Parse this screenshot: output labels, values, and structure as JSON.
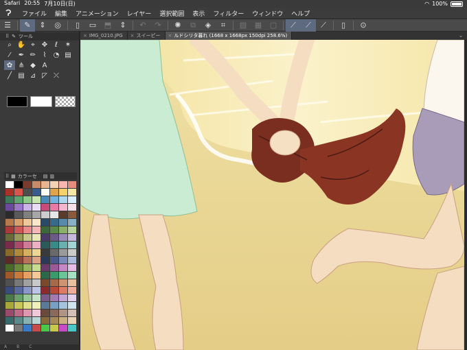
{
  "status": {
    "browser": "Safari",
    "time": "20:55",
    "date": "7月10日(日)",
    "battery": "100%",
    "battery_level": 1.0
  },
  "menubar": {
    "items": [
      "ファイル",
      "編集",
      "アニメーション",
      "レイヤー",
      "選択範囲",
      "表示",
      "フィルター",
      "ウィンドウ",
      "ヘルプ"
    ]
  },
  "tool_panel": {
    "tab_label": "ツール"
  },
  "palette_panel": {
    "tab_label": "カラーセ",
    "colors": [
      "#ffffff",
      "#000000",
      "#7a3b2e",
      "#c78b6a",
      "#e8b58f",
      "#f3d2b5",
      "#f7b6b0",
      "#e88c7d",
      "#a83226",
      "#d9544b",
      "#4d4d4d",
      "#3a5a8c",
      "#ffffff",
      "#e0a24a",
      "#f5d06b",
      "#f6e9a8",
      "#3d7a5a",
      "#5fa36f",
      "#8fc98a",
      "#c8e6b0",
      "#4a8ab8",
      "#74b3dc",
      "#aed7ee",
      "#dcefff",
      "#6a4a9a",
      "#9a7ac8",
      "#c9b3e6",
      "#e9dcf6",
      "#c84a7a",
      "#e87aa8",
      "#f4b6ce",
      "#fbe0ea",
      "#2b2b2b",
      "#595959",
      "#808080",
      "#a6a6a6",
      "#cccccc",
      "#e6e6e6",
      "#5a3a2a",
      "#8a5a3a",
      "#b87a4a",
      "#d8a06a",
      "#efc79a",
      "#fbe6c8",
      "#2a4a6a",
      "#3a6a8a",
      "#5a8aaa",
      "#8ab0c8",
      "#aa3a3a",
      "#cc5a5a",
      "#e88a8a",
      "#f5b8b8",
      "#3a6a3a",
      "#5a8a4a",
      "#8ab06a",
      "#b8d49a",
      "#6a6a3a",
      "#9a9a5a",
      "#c8c88a",
      "#e8e8b8",
      "#4a3a6a",
      "#6a5a8a",
      "#9a8ab8",
      "#c8b8e0",
      "#7a2a4a",
      "#a84a6a",
      "#d07a98",
      "#ecb0c4",
      "#2a5a5a",
      "#3a8a8a",
      "#6ab0b0",
      "#a0d4d4",
      "#8a6a2a",
      "#b08a3a",
      "#d4b060",
      "#ecd694",
      "#3a3a3a",
      "#6a6a6a",
      "#9a9a9a",
      "#cacaca",
      "#5a2a2a",
      "#8a4a3a",
      "#b8745a",
      "#dca486",
      "#2a3a5a",
      "#4a5a8a",
      "#7a8ab8",
      "#acbadc",
      "#4a6a2a",
      "#6a8a3a",
      "#9ab45a",
      "#c8dc90",
      "#6a3a6a",
      "#9a5a9a",
      "#c488c4",
      "#e4bce4",
      "#a05a2a",
      "#c87a3a",
      "#e8a060",
      "#f6c898",
      "#2a6a4a",
      "#3a9a6a",
      "#6ac498",
      "#a4e0c4",
      "#505050",
      "#787878",
      "#a0a0a0",
      "#c8c8c8",
      "#7a4a2a",
      "#a46a4a",
      "#cc9470",
      "#e8c0a0",
      "#3a4a7a",
      "#5a6aa0",
      "#8a98c8",
      "#bcc6e4",
      "#8a2a2a",
      "#b84a3a",
      "#dc7a64",
      "#f0ac98",
      "#4a7a4a",
      "#6aa06a",
      "#98c898",
      "#c8e4c8",
      "#7a5a8a",
      "#a07ab0",
      "#c4a4d4",
      "#e4d0ee",
      "#a8a83a",
      "#c8c85a",
      "#e0e08a",
      "#f0f0bc",
      "#5a7a9a",
      "#7aa0c0",
      "#a4c4dc",
      "#d0e4f0",
      "#9a4a6a",
      "#c06a8a",
      "#dc98b0",
      "#f0c8d8",
      "#6a4a3a",
      "#8a6a5a",
      "#b09484",
      "#d4c0b4",
      "#3a6a6a",
      "#5a8a8a",
      "#8ab0b0",
      "#b8d4d4",
      "#886a3a",
      "#a88a5a",
      "#ccb084",
      "#e8d4b4",
      "#ffffff",
      "#7a7a7a",
      "#3a7ac8",
      "#c84a4a",
      "#4ac84a",
      "#c8c84a",
      "#c84ac8",
      "#4ac8c8"
    ],
    "footer": [
      "A",
      "B",
      "C"
    ]
  },
  "doc_tabs": [
    {
      "label": "IMG_0210.JPG",
      "active": false
    },
    {
      "label": "スイーピー",
      "active": false
    },
    {
      "label": "ルドシリタ暮れ (1668 x 1668px 150dpi 258.6%)",
      "active": true
    }
  ]
}
